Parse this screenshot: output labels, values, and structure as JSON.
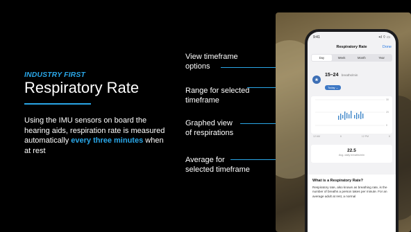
{
  "slide": {
    "eyebrow": "INDUSTRY FIRST",
    "title": "Respiratory Rate",
    "body_before": "Using the IMU sensors on board the hearing aids, respiration rate is measured automatically ",
    "body_highlight": "every three minutes",
    "body_after": " when at rest"
  },
  "callouts": [
    {
      "line1": "View timeframe",
      "line2": "options"
    },
    {
      "line1": "Range for selected",
      "line2": "timeframe"
    },
    {
      "line1": "Graphed view",
      "line2": "of respirations"
    },
    {
      "line1": "Average for",
      "line2": "selected timeframe"
    }
  ],
  "phone": {
    "time": "9:41",
    "signal": "•ıl ⌔ ▭",
    "title": "Respiratory Rate",
    "done": "Done",
    "tabs": [
      "Day",
      "Week",
      "Month",
      "Year"
    ],
    "selected_tab": "Day",
    "range_value": "15–24",
    "range_unit": "breaths/min",
    "range_pill": "Today ⌄",
    "chart_ticks": [
      "12 AM",
      "6",
      "12 PM",
      "6"
    ],
    "chart_yticks": [
      "30",
      "20",
      "0"
    ],
    "average_value": "22.5",
    "average_label": "Avg. daily breaths/min",
    "info_heading": "What is a Respiratory Rate?",
    "info_text": "Respiratory rate, also known as breathing rate, is the number of breaths a person takes per minute. For an average adult at rest, a normal"
  },
  "colors": {
    "accent": "#2aa7e8",
    "background": "#000000"
  }
}
